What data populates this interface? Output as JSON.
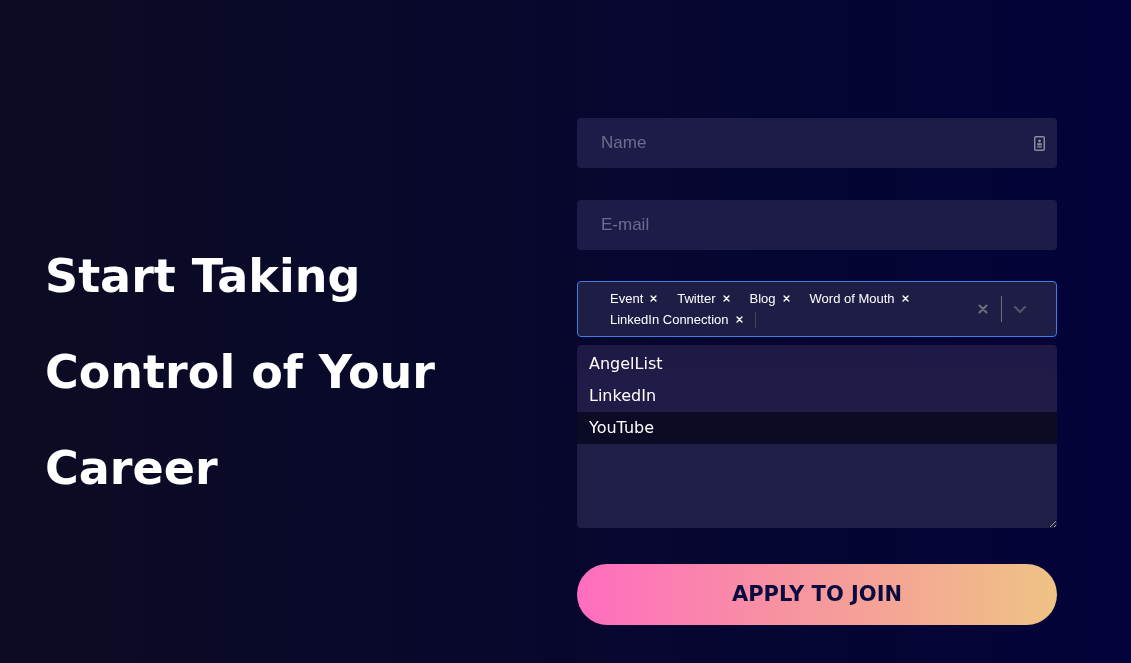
{
  "hero": {
    "heading_lines": [
      "Start Taking",
      "Control of Your",
      "Career"
    ]
  },
  "form": {
    "name_field": {
      "placeholder": "Name"
    },
    "email_field": {
      "placeholder": "E-mail"
    },
    "source_select": {
      "focused": true,
      "tags": [
        {
          "label": "Event"
        },
        {
          "label": "Twitter"
        },
        {
          "label": "Blog"
        },
        {
          "label": "Word of Mouth"
        },
        {
          "label": "LinkedIn Connection"
        }
      ],
      "menu": [
        {
          "label": "AngelList",
          "selected": false
        },
        {
          "label": "LinkedIn",
          "selected": false
        },
        {
          "label": "YouTube",
          "selected": true
        }
      ]
    },
    "submit_button": {
      "label": "APPLY TO JOIN"
    }
  }
}
